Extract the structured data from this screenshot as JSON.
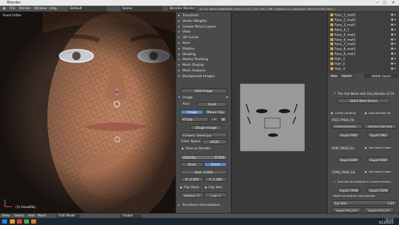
{
  "window": {
    "title": "Blender",
    "min": "—",
    "max": "□",
    "close": "✕"
  },
  "header": {
    "menus": [
      "File",
      "Render",
      "Window",
      "Help"
    ],
    "layout": "Default",
    "scene": "Scene",
    "engine": "Blender Render",
    "stats": "v2.74 | Verts:3,606/8,838 | Faces:3,711/7,734 | Tris:7,398 | Objects:1/4 | Lamps:0/0 | Mem:51.02M | Face_1"
  },
  "viewport": {
    "label": "Front Ortho",
    "object_label": "(1) HeadObj",
    "mode": "Edit Mode",
    "pivot": "Global"
  },
  "shelf": {
    "rows": [
      {
        "label": "Transform",
        "open": false
      },
      {
        "label": "Vertex Weights",
        "open": false
      },
      {
        "label": "Grease Pencil Layers",
        "open": false
      },
      {
        "label": "View",
        "open": false
      },
      {
        "label": "3D Cursor",
        "open": false
      },
      {
        "label": "Item",
        "open": false
      },
      {
        "label": "Display",
        "open": false
      },
      {
        "label": "Shading",
        "open": false
      },
      {
        "label": "Motion Tracking",
        "open": false
      },
      {
        "label": "Mesh Display",
        "open": false
      },
      {
        "label": "Mesh Analysis",
        "open": false
      },
      {
        "label": "Background Images",
        "open": true
      }
    ],
    "add_image": "Add Image",
    "image_name": "Image",
    "axis_label": "Axis:",
    "axis_value": "Front",
    "source_image": "Image",
    "source_clip": "Movie Clip",
    "img_field": "kif.jpg",
    "single_image": "Single Image",
    "file_path": "C:\\Users\\...\\Face1.jpg",
    "color_space_label": "Color Space",
    "color_space_value": "sRGB",
    "view_as_render": "View as Render",
    "opacity_label": "Opacity",
    "opacity_value": "0.514",
    "back": "Back",
    "front": "Front",
    "size_label": "Size:",
    "size_value": "5.000",
    "x_value": "X: 0.000",
    "y_value": "Y: 1.380",
    "flip_h": "Flip Horiz",
    "flip_v": "Flip Vert",
    "rotation": "Rotation: 0°",
    "crop": "Crop: 0",
    "transform_orient": "Transform Orientations"
  },
  "outliner": {
    "items": [
      "Face_1_mat1",
      "Face_2_mat1",
      "Face_3_mat1",
      "Face_4_1",
      "Face_5_mat1",
      "Face_6_mat1",
      "Face_7_mat1",
      "Face_8_mat1",
      "Face_9_mat1",
      "Hair_1",
      "Hair_2",
      "Hair_3"
    ]
  },
  "props": {
    "tabs": [
      "View",
      "Search",
      "Visible Layers"
    ],
    "note": "This Tool Works with Only Blender v2.74",
    "start_scene": "Start New Scene",
    "create_cams": "Create cameras",
    "auto_smooth": "Auto Smooth He",
    "face_file_label": "FACE_FMG8_File",
    "face_path": "C:\\Users\\user\\Ap...",
    "face_file": "Bar/face_high.fmg",
    "import_fmg": "Import FMG",
    "export_fmg": "Export FMG",
    "hair_label": "HAIR_FMG8_File",
    "same_folder": "Use Same Folder",
    "import_hair": "Import HAIR",
    "export_hair": "Export HAIR",
    "cran_label": "CRAN_FMG8_File",
    "same_folder2": "Use Same Folder",
    "warn": "And that not available in current directory",
    "import_cran": "Import CRAN",
    "export_cran": "Export CRAN",
    "model_warn": "Model not position now available",
    "eye_label": "Eye Size",
    "eye_value": "1.03",
    "import_pgs": "Import PGS_OFF",
    "export_pgs": "Export PGS_OFF"
  },
  "taskbar": {
    "time": "12:13",
    "date": "5/13/2015"
  }
}
